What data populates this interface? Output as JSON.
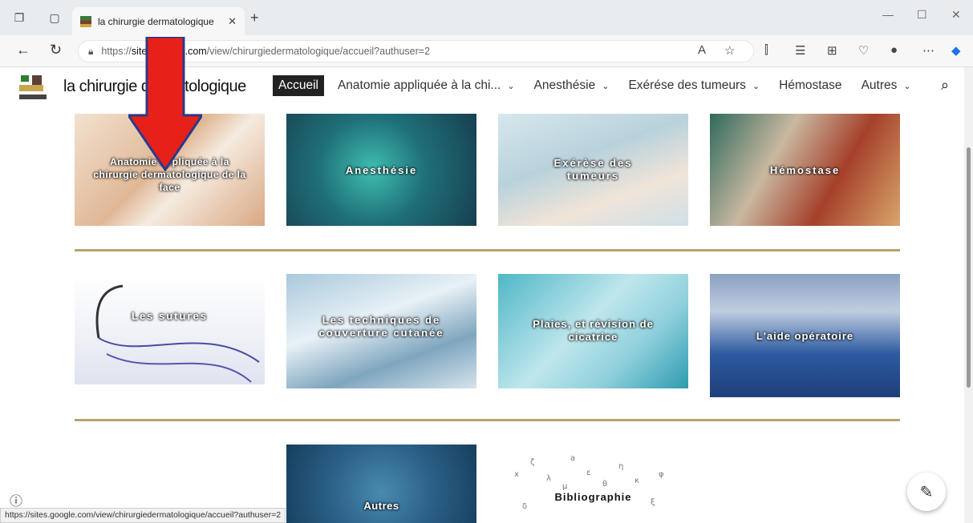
{
  "browser": {
    "tab_title": "la chirurgie dermatologique",
    "url_prefix": "https://",
    "url_domain": "sites.google.com",
    "url_path": "/view/chirurgiedermatologique/accueil?authuser=2",
    "status_url": "https://sites.google.com/view/chirurgiedermatologique/accueil?authuser=2"
  },
  "site": {
    "title": "la chirurgie dermatologique",
    "menu": [
      {
        "label": "Accueil"
      },
      {
        "label": "Anatomie appliquée à la chi..."
      },
      {
        "label": "Anesthésie"
      },
      {
        "label": "Exérése des tumeurs"
      },
      {
        "label": "Hémostase"
      },
      {
        "label": "Autres"
      }
    ]
  },
  "tiles": {
    "anatomie": "Anatomie appliquée à la chirurgie dermatologique de la face",
    "anesthesie": "Anesthésie",
    "exerese": "Exérèse des tumeurs",
    "hemostase": "Hémostase",
    "sutures": "Les sutures",
    "techniques": "Les techniques de couverture cutanée",
    "plaies": "Plaies, et révision de cicatrice",
    "aide": "L'aide opératoire",
    "autres": "Autres",
    "bibliographie": "Bibliographie"
  },
  "colors": {
    "divider": "#b5a46a",
    "arrow": "#e8201a",
    "active_menu_bg": "#222222"
  }
}
